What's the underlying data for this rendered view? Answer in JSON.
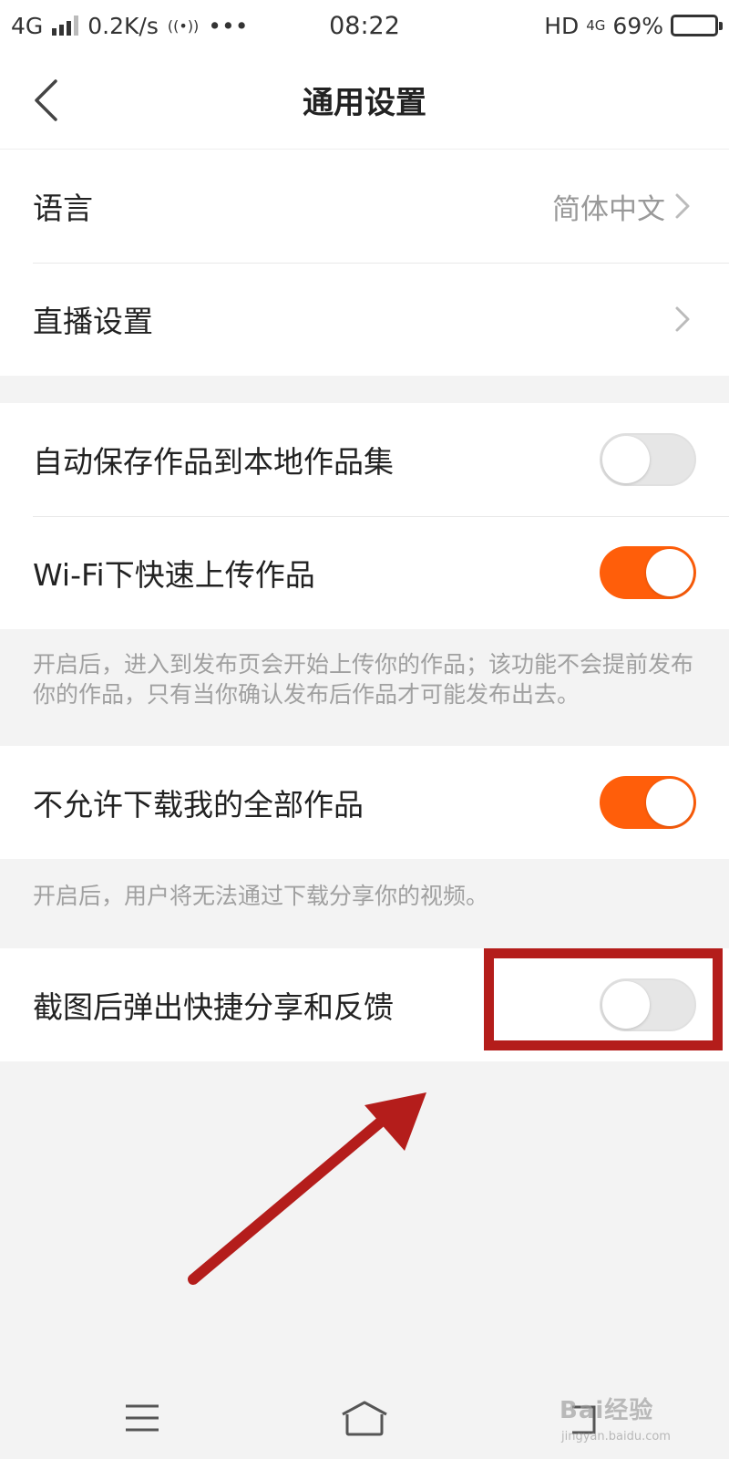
{
  "status_bar": {
    "network": "4G",
    "speed": "0.2K/s",
    "hotspot_icon": "((•))",
    "more": "•••",
    "time": "08:22",
    "hd": "HD",
    "net2": "4G",
    "battery_percent": "69%",
    "battery_level": 0.69
  },
  "nav": {
    "title": "通用设置",
    "back_icon": "chevron-left-icon"
  },
  "group1": {
    "language_label": "语言",
    "language_value": "简体中文",
    "live_label": "直播设置"
  },
  "group2": {
    "autosave_label": "自动保存作品到本地作品集",
    "autosave_on": false,
    "wifi_upload_label": "Wi-Fi下快速上传作品",
    "wifi_upload_on": true,
    "wifi_upload_desc": "开启后，进入到发布页会开始上传你的作品；该功能不会提前发布你的作品，只有当你确认发布后作品才可能发布出去。"
  },
  "group3": {
    "no_download_label": "不允许下载我的全部作品",
    "no_download_on": true,
    "no_download_desc": "开启后，用户将无法通过下载分享你的视频。"
  },
  "group4": {
    "screenshot_share_label": "截图后弹出快捷分享和反馈",
    "screenshot_share_on": false
  },
  "bottom_nav": {
    "items": [
      "menu-icon",
      "home-icon",
      "back-icon"
    ]
  },
  "watermark": {
    "main": "Bai经验",
    "sub": "jingyan.baidu.com"
  },
  "colors": {
    "accent": "#ff5e0a",
    "annotation": "#b41d1b"
  }
}
